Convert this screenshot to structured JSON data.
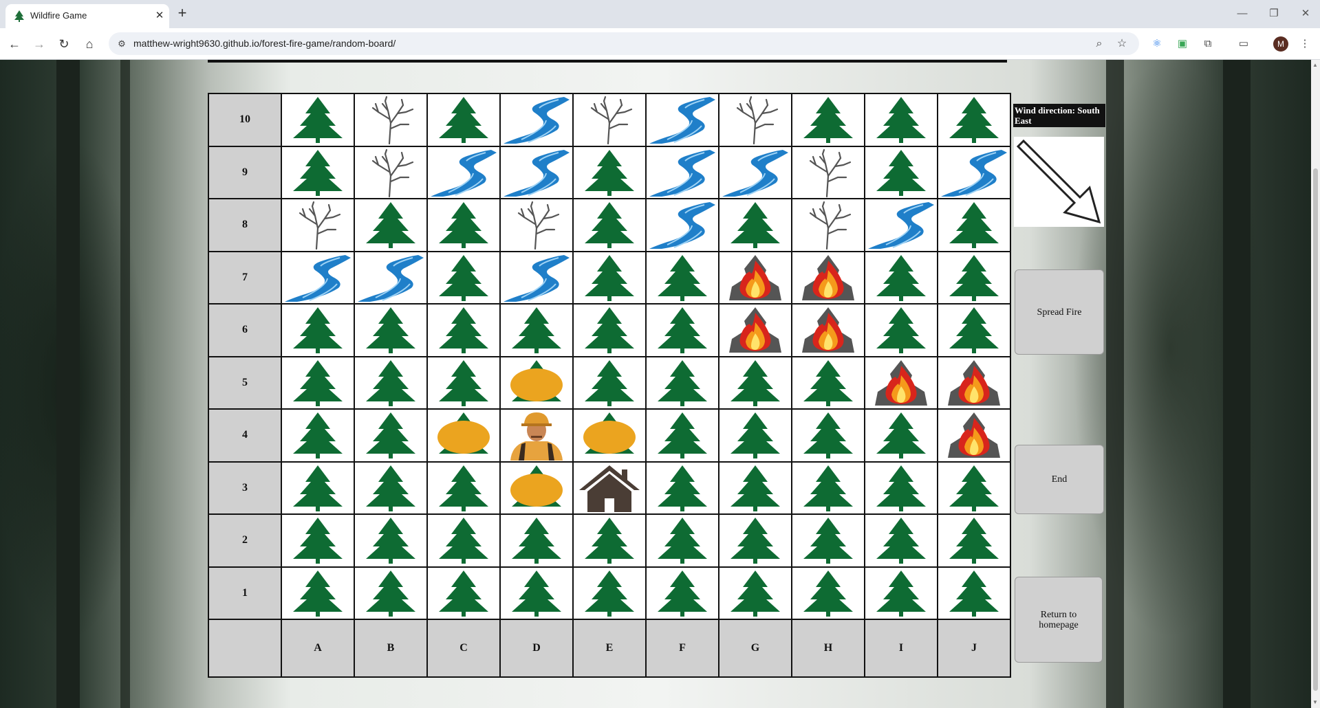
{
  "browser": {
    "tab_title": "Wildfire Game",
    "url": "matthew-wright9630.github.io/forest-fire-game/random-board/",
    "profile_initial": "M"
  },
  "game": {
    "wind_label": "Wind direction: South East",
    "wind_direction": "south-east",
    "buttons": {
      "spread_fire": "Spread Fire",
      "end": "End",
      "return_home": "Return to homepage"
    },
    "row_labels": [
      "10",
      "9",
      "8",
      "7",
      "6",
      "5",
      "4",
      "3",
      "2",
      "1"
    ],
    "col_labels": [
      "A",
      "B",
      "C",
      "D",
      "E",
      "F",
      "G",
      "H",
      "I",
      "J"
    ],
    "grid": [
      [
        "tree",
        "dead-tree",
        "tree",
        "river",
        "dead-tree",
        "river",
        "dead-tree",
        "tree",
        "tree",
        "tree"
      ],
      [
        "tree",
        "dead-tree",
        "river",
        "river",
        "tree",
        "river",
        "river",
        "dead-tree",
        "tree",
        "river"
      ],
      [
        "dead-tree",
        "tree",
        "tree",
        "dead-tree",
        "tree",
        "river",
        "tree",
        "dead-tree",
        "river",
        "tree"
      ],
      [
        "river",
        "river",
        "tree",
        "river",
        "tree",
        "tree",
        "fire",
        "fire",
        "tree",
        "tree"
      ],
      [
        "tree",
        "tree",
        "tree",
        "tree",
        "tree",
        "tree",
        "fire",
        "fire",
        "tree",
        "tree"
      ],
      [
        "tree",
        "tree",
        "tree",
        "firebreak",
        "tree",
        "tree",
        "tree",
        "tree",
        "fire",
        "fire"
      ],
      [
        "tree",
        "tree",
        "firebreak",
        "firefighter",
        "firebreak",
        "tree",
        "tree",
        "tree",
        "tree",
        "fire"
      ],
      [
        "tree",
        "tree",
        "tree",
        "firebreak",
        "house",
        "tree",
        "tree",
        "tree",
        "tree",
        "tree"
      ],
      [
        "tree",
        "tree",
        "tree",
        "tree",
        "tree",
        "tree",
        "tree",
        "tree",
        "tree",
        "tree"
      ],
      [
        "tree",
        "tree",
        "tree",
        "tree",
        "tree",
        "tree",
        "tree",
        "tree",
        "tree",
        "tree"
      ]
    ]
  }
}
